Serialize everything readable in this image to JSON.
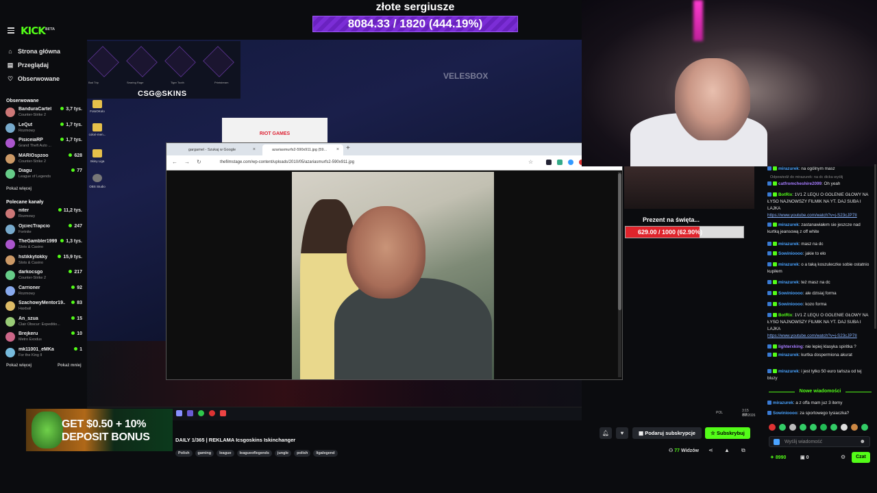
{
  "header": {
    "logo": "KICK",
    "logo_beta": "BETA"
  },
  "overlay": {
    "goal_title": "złote sergiusze",
    "goal_value": "8084.33 / 1820 (444.19%)"
  },
  "sidebar": {
    "nav": [
      {
        "label": "Strona główna",
        "icon": "home-icon"
      },
      {
        "label": "Przeglądaj",
        "icon": "browse-icon"
      },
      {
        "label": "Obserwowane",
        "icon": "heart-icon"
      }
    ],
    "followed_title": "Obserwowane",
    "followed": [
      {
        "name": "BanduraCartel",
        "game": "Counter-Strike 2",
        "viewers": "3,7 tys."
      },
      {
        "name": "LeQut",
        "game": "Rozmowy",
        "viewers": "1,7 tys."
      },
      {
        "name": "PisiceiaRP",
        "game": "Grand Theft Auto ...",
        "viewers": "1,7 tys."
      },
      {
        "name": "MARIOspzoo",
        "game": "Counter-Strike 2",
        "viewers": "628"
      },
      {
        "name": "Diagu",
        "game": "League of Legends",
        "viewers": "77"
      }
    ],
    "show_more_1": "Pokaż więcej",
    "recommended_title": "Polecane kanały",
    "recommended": [
      {
        "name": "niter",
        "game": "Rozmowy",
        "viewers": "11,2 tys."
      },
      {
        "name": "OjciecTrapcio",
        "game": "Fortnite",
        "viewers": "247"
      },
      {
        "name": "TheGambler1999",
        "game": "Slots & Casino",
        "viewers": "1,3 tys."
      },
      {
        "name": "hstikkytokky",
        "game": "Slots & Casino",
        "viewers": "15,9 tys."
      },
      {
        "name": "darkocsgo",
        "game": "Counter-Strike 2",
        "viewers": "217"
      },
      {
        "name": "Carrioner",
        "game": "Rozmowy",
        "viewers": "92"
      },
      {
        "name": "SzachowyMentor19...",
        "game": "Haxball",
        "viewers": "83"
      },
      {
        "name": "An_szua",
        "game": "Clair Obscur: Expeditio...",
        "viewers": "15"
      },
      {
        "name": "Brejkeru",
        "game": "Metro Exodus",
        "viewers": "10"
      },
      {
        "name": "mk11001_eMKa",
        "game": "For the King II",
        "viewers": "1"
      }
    ],
    "show_more_2": "Pokaż więcej",
    "show_less": "Pokaż mniej"
  },
  "stream_scene": {
    "skins_title": "CSG◎SKINS",
    "skin_names": [
      "Bad Trip",
      "Searing Rage",
      "Tiger Tooth",
      "Printstream"
    ],
    "velesbox": "VELESBOX",
    "riot": "RIOT GAMES",
    "desktop_icons": [
      "FotoOKolo",
      "colori-men...",
      "Skiny Liga",
      "OBS Studio"
    ]
  },
  "browser": {
    "tabs": [
      {
        "label": "gargamel - Szukaj w Google"
      },
      {
        "label": "azariasmurfs2-590x911.jpg (59..."
      }
    ],
    "url": "thefilmstage.com/wp-content/uploads/2010/05/azariasmurfs2-590x911.jpg"
  },
  "taskbar": {
    "lang": "POL",
    "time": "3:15 AM",
    "date": "1/2/2026"
  },
  "gift_overlay": {
    "title": "Prezent na święta...",
    "value": "629.00 / 1000 (62.90%)",
    "progress": 0.629
  },
  "chat": {
    "messages": [
      {
        "user": "mirazurek",
        "text": "na ogólnym masz",
        "color": "#4aa3ff"
      },
      {
        "reply": "Odpowiedź do mirazurek: na dc dicka wyślij"
      },
      {
        "user": "catfromcheshire2099",
        "text": "Oh yeah",
        "color": "#a67cff"
      },
      {
        "user": "BotRix",
        "text": "1V1 Z LEQU O GOLENIE GŁOWY NA ŁYSO NAJNOWSZY FILMIK NA YT. DAJ SUBA I LAJKA",
        "link": "https://www.youtube.com/watch?v=j-S23cJP7II",
        "color": "#53fc18"
      },
      {
        "user": "mirazurek",
        "text": "zastanawiałem sie jeszcze nad kurtką jeansową z off white",
        "color": "#4aa3ff"
      },
      {
        "user": "mirazurek",
        "text": "masz na dc",
        "color": "#4aa3ff"
      },
      {
        "user": "Sowinioooo",
        "text": "jakie to eło",
        "color": "#4aa3ff"
      },
      {
        "user": "mirazurek",
        "text": "o a taką koszuleczke sobie ostatnio kupiłem",
        "color": "#4aa3ff"
      },
      {
        "user": "mirazurek",
        "text": "też masz na dc",
        "color": "#4aa3ff"
      },
      {
        "user": "Sowinioooo",
        "text": "ale dzisiaj forma",
        "color": "#4aa3ff"
      },
      {
        "user": "Sowinioooo",
        "text": "kozo forma",
        "color": "#4aa3ff"
      },
      {
        "user": "BotRix",
        "text": "1V1 Z LEQU O GOLENIE GŁOWY NA ŁYSO NAJNOWSZY FILMIK NA YT. DAJ SUBA I LAJKA",
        "link": "https://www.youtube.com/watch?v=j-S23cJP7II",
        "color": "#53fc18"
      },
      {
        "user": "lighterxking",
        "text": "nie lepiej klasyka spiritka ?",
        "color": "#a67cff"
      },
      {
        "user": "mirazurek",
        "text": "kurtka dospermiona akurat",
        "color": "#4aa3ff"
      },
      {
        "user": "mirazurek",
        "text": "i jest tylko 50 euro tańsza od tej bluzy",
        "color": "#4aa3ff"
      }
    ],
    "new_messages_label": "Nowe wiadomości",
    "new_messages": [
      {
        "user": "mirazurek",
        "text": "a z offa mam juz 3 itemy",
        "color": "#4aa3ff"
      },
      {
        "user": "Sowinioooo",
        "text": "za sportowego tysiaczka?",
        "color": "#4aa3ff"
      }
    ],
    "input_placeholder": "Wyślij wiadomość",
    "points": "8990",
    "points2": "0",
    "chat_button": "Czat"
  },
  "below_stream": {
    "ad_line1": "GET $0.50 + 10%",
    "ad_line2": "DEPOSIT BONUS",
    "title": "DAILY 1/365 | REKLAMA Icsgoskins Iskinchanger",
    "tags": [
      "Polish",
      "gaming",
      "league",
      "leagueoflegends",
      "jungle",
      "polish",
      "ligalegend"
    ],
    "gift_sub": "Podaruj subskrypcje",
    "subscribe": "Subskrybuj",
    "viewers": "77",
    "viewers_label": "Widzów"
  },
  "colors": {
    "accent": "#53fc18",
    "goal_purple": "#7b2dd6"
  }
}
